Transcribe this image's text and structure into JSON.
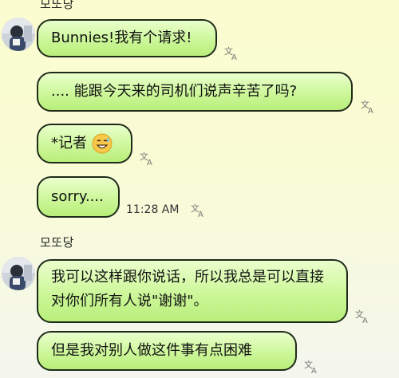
{
  "chat": {
    "group1": {
      "sender_name": "모또당",
      "messages": [
        {
          "text": "Bunnies!我有个请求!"
        },
        {
          "text": ".... 能跟今天来的司机们说声辛苦了吗?"
        },
        {
          "text": "*记者",
          "emoji": "sweat-smile-emoji"
        },
        {
          "text": "sorry...."
        }
      ],
      "timestamp": "11:28 AM"
    },
    "group2": {
      "sender_name": "모또당",
      "messages": [
        {
          "text": "我可以这样跟你说话，所以我总是可以直接对你们所有人说\"谢谢\"。"
        },
        {
          "text": "但是我对别人做这件事有点困难"
        }
      ]
    }
  },
  "icons": {
    "translate": "translate-icon",
    "avatar": "avatar"
  },
  "colors": {
    "bubble_top": "#eaffcc",
    "bubble_bottom": "#b8ee7a",
    "bubble_border": "#1f2a1a",
    "background_top": "#fbfccf",
    "background_bottom": "#f4f6ee"
  }
}
